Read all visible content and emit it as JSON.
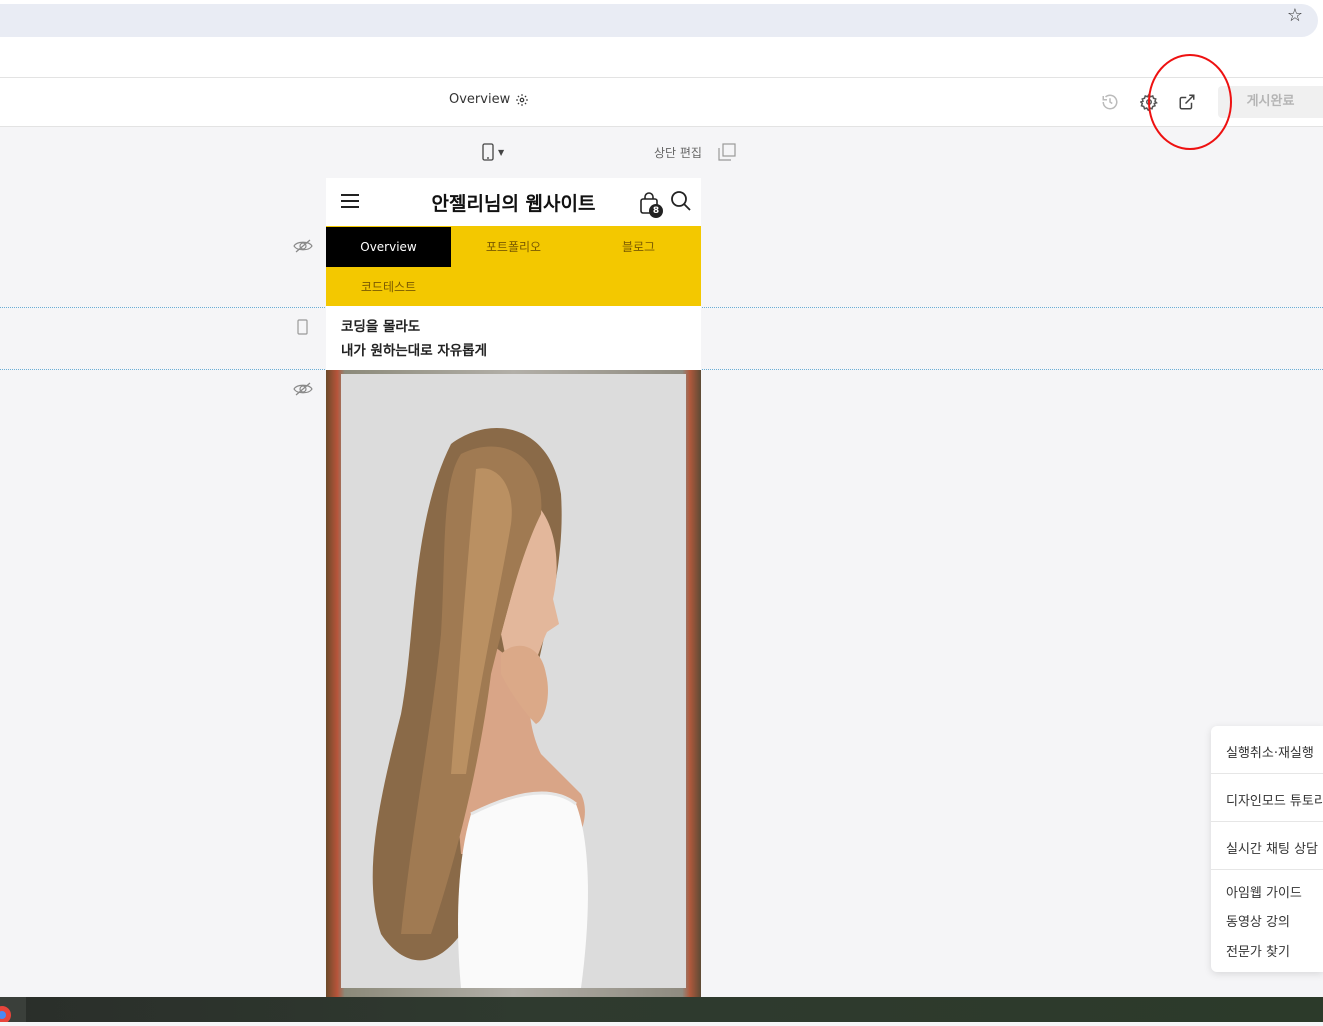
{
  "toolbar": {
    "page_name": "Overview",
    "publish_label": "게시완료"
  },
  "canvas": {
    "top_edit_label": "상단 편집"
  },
  "site": {
    "title": "안젤리님의 웹사이트",
    "cart_count": "8",
    "nav": [
      {
        "label": "Overview",
        "active": true
      },
      {
        "label": "포트폴리오"
      },
      {
        "label": "블로그"
      },
      {
        "label": "코드테스트"
      }
    ],
    "headline": [
      "코딩을 몰라도",
      "내가 원하는대로 자유롭게"
    ]
  },
  "help_menu": {
    "items": [
      "실행취소·재실행",
      "디자인모드 튜토리",
      "실시간 채팅 상담",
      "아임웹 가이드",
      "동영상 강의",
      "전문가 찾기"
    ]
  },
  "colors": {
    "nav_bg": "#f3c800",
    "active_tab": "#000000",
    "highlight_circle": "#e11111"
  }
}
